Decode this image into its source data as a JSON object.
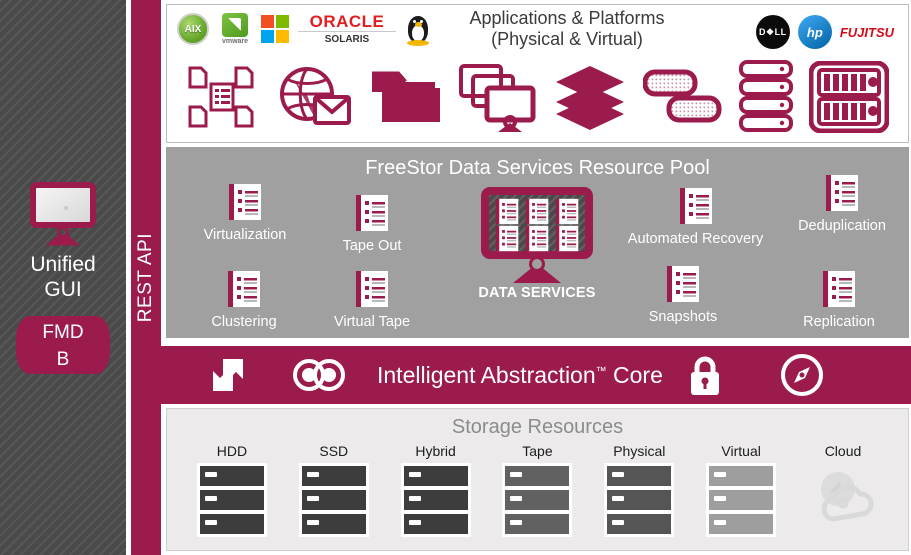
{
  "sidebar": {
    "gui_label": "Unified\nGUI",
    "gui_line1": "Unified",
    "gui_line2": "GUI",
    "fmdb_line1": "FMD",
    "fmdb_line2": "B",
    "fmdb_full": "FMDB",
    "monitor_icon": "monitor-icon"
  },
  "rest_api": {
    "label": "REST API"
  },
  "applications": {
    "title_line1": "Applications & Platforms",
    "title_line2": "(Physical & Virtual)",
    "os_logos": [
      {
        "name": "aix-logo",
        "text": "AIX"
      },
      {
        "name": "vmware-logo",
        "text": "vmware"
      },
      {
        "name": "microsoft-logo",
        "text": ""
      },
      {
        "name": "oracle-solaris-logo",
        "text": "ORACLE",
        "subtext": "SOLARIS"
      },
      {
        "name": "linux-tux-logo",
        "text": ""
      }
    ],
    "vendor_logos": [
      {
        "name": "dell-logo",
        "text": "D❖LL"
      },
      {
        "name": "hp-logo",
        "text": "hp"
      },
      {
        "name": "fujitsu-logo",
        "text": "FUJITSU"
      }
    ],
    "icons": [
      "documents-network-icon",
      "web-mail-globe-icon",
      "folder-icon",
      "virtual-desktops-icon",
      "stacked-layers-icon",
      "storage-array-icon",
      "rack-servers-icon",
      "blade-chassis-icon"
    ]
  },
  "pool": {
    "title": "FreeStor Data Services Resource Pool",
    "center": {
      "label": "DATA SERVICES",
      "icon": "data-services-monitor-icon"
    },
    "services": [
      {
        "label": "Virtualization",
        "icon": "service-doc-icon"
      },
      {
        "label": "Tape Out",
        "icon": "service-doc-icon"
      },
      {
        "label": "Automated Recovery",
        "icon": "service-doc-icon"
      },
      {
        "label": "Deduplication",
        "icon": "service-doc-icon"
      },
      {
        "label": "Clustering",
        "icon": "service-doc-icon"
      },
      {
        "label": "Virtual Tape",
        "icon": "service-doc-icon"
      },
      {
        "label": "Snapshots",
        "icon": "service-doc-icon"
      },
      {
        "label": "Replication",
        "icon": "service-doc-icon"
      }
    ]
  },
  "core": {
    "title": "Intelligent Abstraction",
    "trademark": "™",
    "title_suffix": " Core",
    "icons": [
      "scale-arrows-icon",
      "mirroring-rings-icon",
      "padlock-icon",
      "compass-disc-icon"
    ]
  },
  "storage": {
    "title": "Storage Resources",
    "items": [
      {
        "label": "HDD",
        "icon": "server-stack-icon",
        "color": "#3d3d3d"
      },
      {
        "label": "SSD",
        "icon": "server-stack-icon",
        "color": "#3d3d3d"
      },
      {
        "label": "Hybrid",
        "icon": "server-stack-icon",
        "color": "#3d3d3d"
      },
      {
        "label": "Tape",
        "icon": "server-stack-icon",
        "color": "#616161"
      },
      {
        "label": "Physical",
        "icon": "server-stack-icon",
        "color": "#555555"
      },
      {
        "label": "Virtual",
        "icon": "server-stack-icon",
        "color": "#9e9e9e"
      },
      {
        "label": "Cloud",
        "icon": "cloud-icon",
        "color": "#dcdcdc"
      }
    ]
  },
  "colors": {
    "brand_maroon": "#9B1B4D",
    "pool_grey": "#A0A0A0",
    "sidebar_grey": "#4A4A4A",
    "storage_panel": "#ECEAEA"
  }
}
